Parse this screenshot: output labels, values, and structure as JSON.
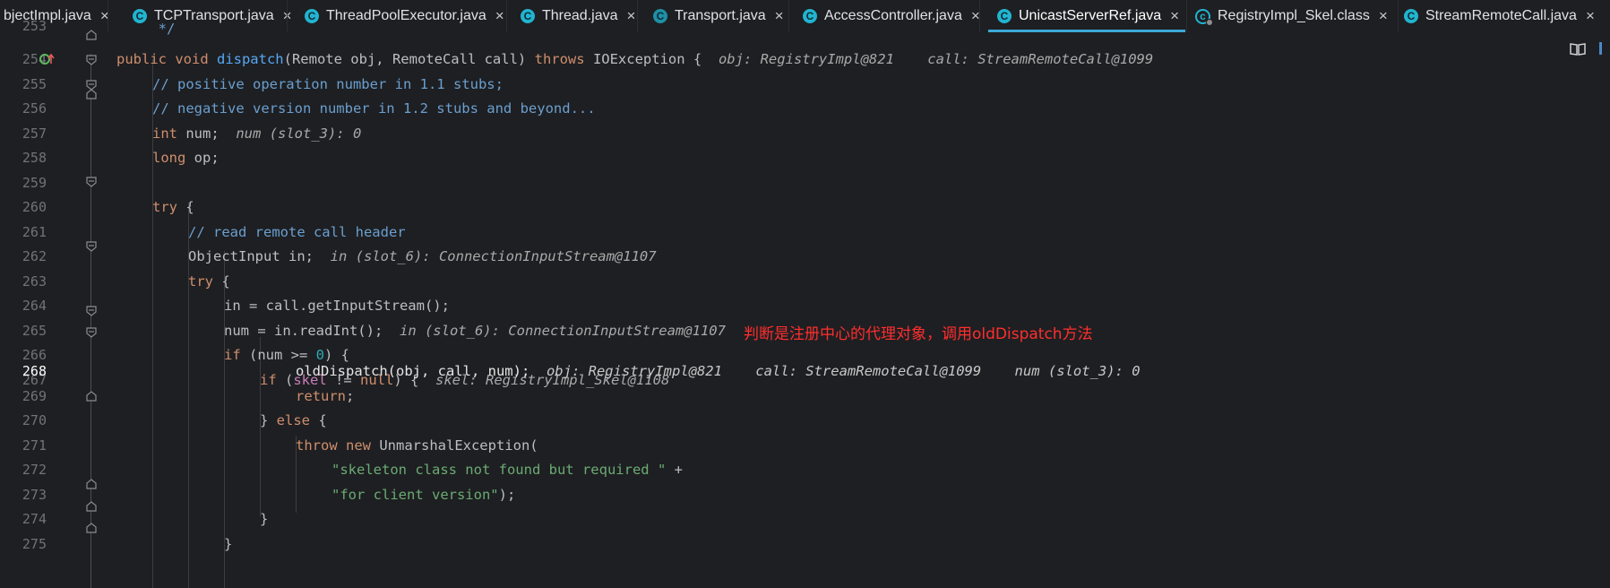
{
  "tabs": [
    {
      "label": "bjectImpl.java",
      "icon": "none",
      "close": "×"
    },
    {
      "label": "TCPTransport.java",
      "icon": "class-c-icon",
      "close": "×"
    },
    {
      "label": "ThreadPoolExecutor.java",
      "icon": "class-c-icon",
      "close": "×"
    },
    {
      "label": "Thread.java",
      "icon": "class-c-icon",
      "close": "×"
    },
    {
      "label": "Transport.java",
      "icon": "abstract-class-icon",
      "close": "×"
    },
    {
      "label": "AccessController.java",
      "icon": "class-c-icon",
      "close": "×"
    },
    {
      "label": "UnicastServerRef.java",
      "icon": "class-c-icon",
      "close": "×",
      "active": true
    },
    {
      "label": "RegistryImpl_Skel.class",
      "icon": "compiled-class-icon",
      "close": "×"
    },
    {
      "label": "StreamRemoteCall.java",
      "icon": "class-c-icon",
      "close": "×"
    }
  ],
  "gutter": {
    "line_numbers": [
      "254",
      "255",
      "256",
      "257",
      "258",
      "259",
      "260",
      "261",
      "262",
      "263",
      "264",
      "265",
      "266",
      "267",
      "268",
      "269",
      "270",
      "271",
      "272",
      "273",
      "274",
      "275"
    ],
    "current_line": "268",
    "override_marker": "o↑"
  },
  "code": {
    "l254": {
      "kw1": "public void ",
      "fn": "dispatch",
      "rest": "(Remote obj, RemoteCall call) ",
      "kw2": "throws ",
      "rest2": "IOException {",
      "hint": "obj: RegistryImpl@821    call: StreamRemoteCall@1099"
    },
    "l255": {
      "text": "// positive operation number in 1.1 stubs;"
    },
    "l256": {
      "text": "// negative version number in 1.2 stubs and beyond..."
    },
    "l257": {
      "kw": "int ",
      "rest": "num;",
      "hint": "num (slot_3): 0"
    },
    "l258": {
      "kw": "long ",
      "rest": "op;"
    },
    "l260": {
      "kw": "try ",
      "rest": "{"
    },
    "l261": {
      "text": "// read remote call header"
    },
    "l262": {
      "rest": "ObjectInput in;",
      "hint": "in (slot_6): ConnectionInputStream@1107"
    },
    "l263": {
      "kw": "try ",
      "rest": "{"
    },
    "l264": {
      "rest": "in = call.getInputStream();"
    },
    "l265": {
      "rest": "num = in.readInt();",
      "hint": "in (slot_6): ConnectionInputStream@1107"
    },
    "l266": {
      "kw": "if ",
      "rest1": "(num >= ",
      "num": "0",
      "rest2": ") {"
    },
    "l267": {
      "kw": "if ",
      "rest1": "(",
      "field": "skel",
      "rest2": " != ",
      "kw2": "null",
      "rest3": ") {",
      "hint": "skel: RegistryImpl_Skel@1108"
    },
    "l268": {
      "rest": "oldDispatch(obj, call, num);",
      "hint": "obj: RegistryImpl@821    call: StreamRemoteCall@1099    num (slot_3): 0"
    },
    "l269": {
      "kw": "return",
      "rest": ";"
    },
    "l270": {
      "rest1": "} ",
      "kw": "else",
      "rest2": " {"
    },
    "l271": {
      "kw": "throw new ",
      "rest": "UnmarshalException("
    },
    "l272": {
      "str": "\"skeleton class not found but required \"",
      "rest": " +"
    },
    "l273": {
      "str": "\"for client version\"",
      "rest": ");"
    },
    "l274": {
      "rest": "}"
    },
    "l275": {
      "rest": "}"
    }
  },
  "annotation": "判断是注册中心的代理对象，调用oldDispatch方法",
  "colors": {
    "background": "#1e1f22",
    "keyword": "#cf8e6d",
    "method": "#56a8f5",
    "comment": "#6a9fd0",
    "string": "#6aab73",
    "number": "#2aacb8",
    "current_line_highlight": "#0a2d7a",
    "annotation": "#ff2e2e",
    "tab_icon": "#22b4d0"
  }
}
